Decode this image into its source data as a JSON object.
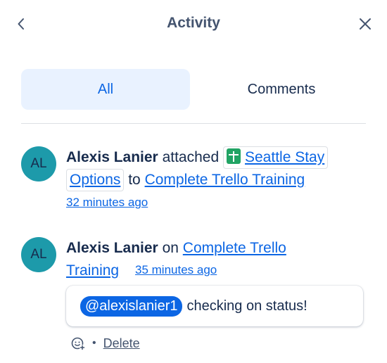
{
  "header": {
    "title": "Activity",
    "back_icon": "chevron-left-icon",
    "close_icon": "close-icon"
  },
  "tabs": [
    {
      "label": "All",
      "active": true
    },
    {
      "label": "Comments",
      "active": false
    }
  ],
  "activities": [
    {
      "avatar_initials": "AL",
      "user": "Alexis Lanier",
      "action": "attached",
      "attachment": {
        "icon": "google-sheets-icon",
        "label_line1": "Seattle Stay",
        "label_line2": "Options"
      },
      "connector": "to",
      "card_link": "Complete Trello Training",
      "time": "32 minutes ago"
    },
    {
      "avatar_initials": "AL",
      "user": "Alexis Lanier",
      "action": "on",
      "card_link_line1": "Complete Trello",
      "card_link_line2": "Training",
      "time": "35 minutes ago",
      "comment": {
        "mention": "@alexislanier1",
        "text": "checking on status!"
      },
      "actions": {
        "react_icon": "add-reaction-icon",
        "separator": "•",
        "delete_label": "Delete"
      }
    }
  ],
  "colors": {
    "accent": "#0c66e4",
    "tab_active_bg": "#e9f2ff",
    "avatar_bg": "#1d9aaa",
    "text": "#172b4d",
    "subtle_text": "#44546f",
    "sheets_green": "#21a464"
  }
}
